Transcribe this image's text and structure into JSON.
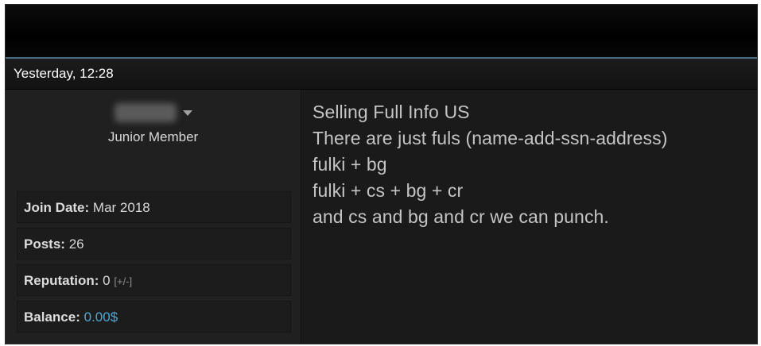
{
  "post": {
    "date": "Yesterday, 12:28",
    "user": {
      "title": "Junior Member",
      "stats": {
        "join_label": "Join Date:",
        "join_value": "Mar 2018",
        "posts_label": "Posts:",
        "posts_value": "26",
        "rep_label": "Reputation:",
        "rep_value": "0",
        "rep_action": "[+/-]",
        "balance_label": "Balance:",
        "balance_value": "0.00$"
      }
    },
    "lines": [
      "Selling Full Info US",
      "There are just fuls (name-add-ssn-address)",
      "fulki + bg",
      "fulki + cs + bg + cr",
      "and cs and bg and cr we can punch."
    ]
  },
  "colors": {
    "accent_line": "#4b6b80",
    "balance": "#4aa8d8"
  }
}
